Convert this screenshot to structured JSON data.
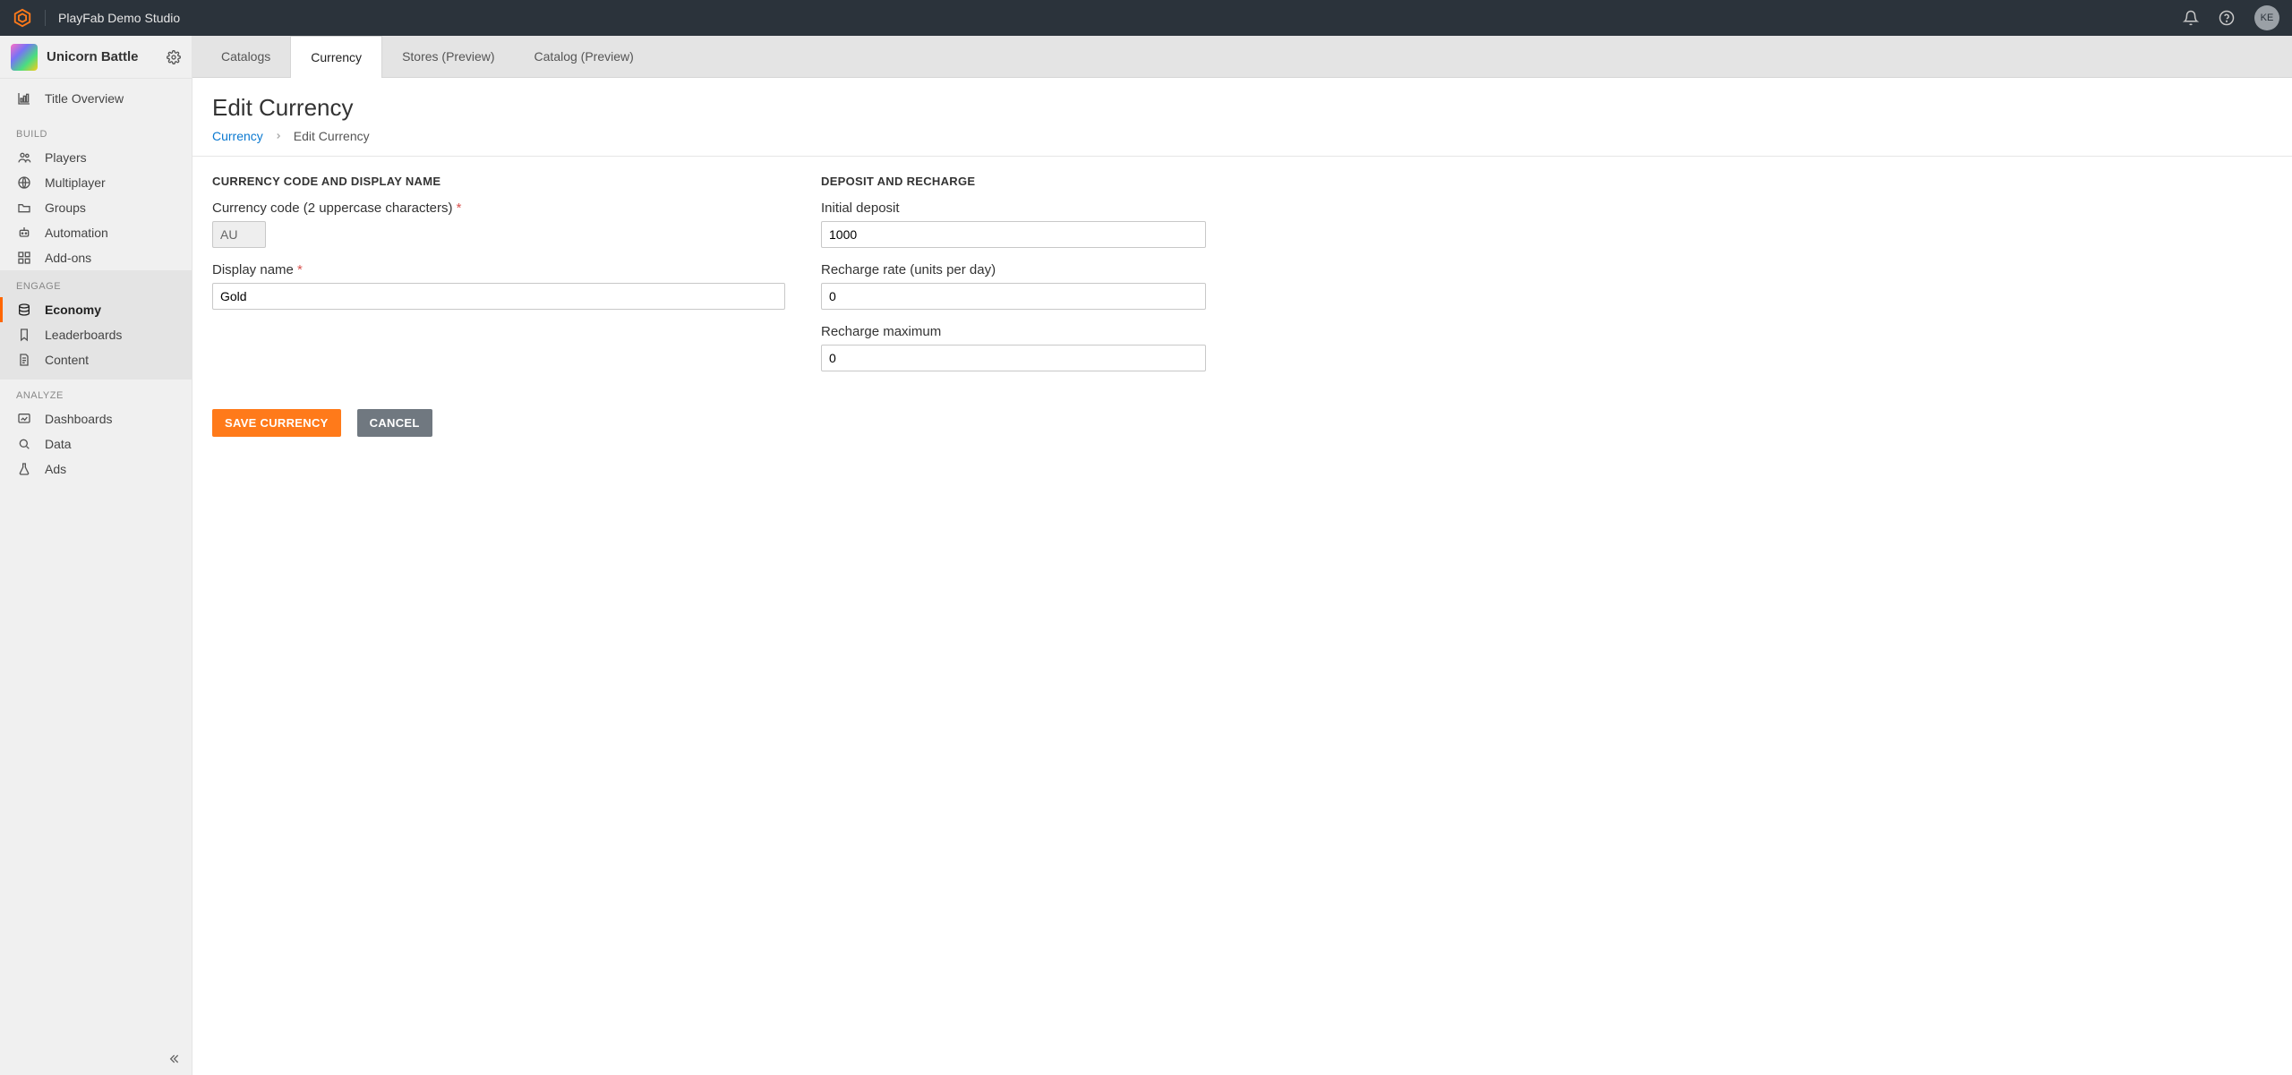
{
  "topbar": {
    "studio_name": "PlayFab Demo Studio",
    "avatar_initials": "KE"
  },
  "sidebar": {
    "title_name": "Unicorn Battle",
    "overview_label": "Title Overview",
    "groups": {
      "build": {
        "label": "BUILD",
        "items": [
          "Players",
          "Multiplayer",
          "Groups",
          "Automation",
          "Add-ons"
        ]
      },
      "engage": {
        "label": "ENGAGE",
        "items": [
          "Economy",
          "Leaderboards",
          "Content"
        ]
      },
      "analyze": {
        "label": "ANALYZE",
        "items": [
          "Dashboards",
          "Data",
          "Ads"
        ]
      }
    }
  },
  "tabs": [
    "Catalogs",
    "Currency",
    "Stores (Preview)",
    "Catalog (Preview)"
  ],
  "page": {
    "title": "Edit Currency",
    "breadcrumb_root": "Currency",
    "breadcrumb_current": "Edit Currency"
  },
  "sections": {
    "left_head": "CURRENCY CODE AND DISPLAY NAME",
    "right_head": "DEPOSIT AND RECHARGE"
  },
  "fields": {
    "currency_code": {
      "label": "Currency code (2 uppercase characters)",
      "value": "AU"
    },
    "display_name": {
      "label": "Display name",
      "value": "Gold"
    },
    "initial_deposit": {
      "label": "Initial deposit",
      "value": "1000"
    },
    "recharge_rate": {
      "label": "Recharge rate (units per day)",
      "value": "0"
    },
    "recharge_max": {
      "label": "Recharge maximum",
      "value": "0"
    }
  },
  "buttons": {
    "save": "SAVE CURRENCY",
    "cancel": "CANCEL"
  }
}
